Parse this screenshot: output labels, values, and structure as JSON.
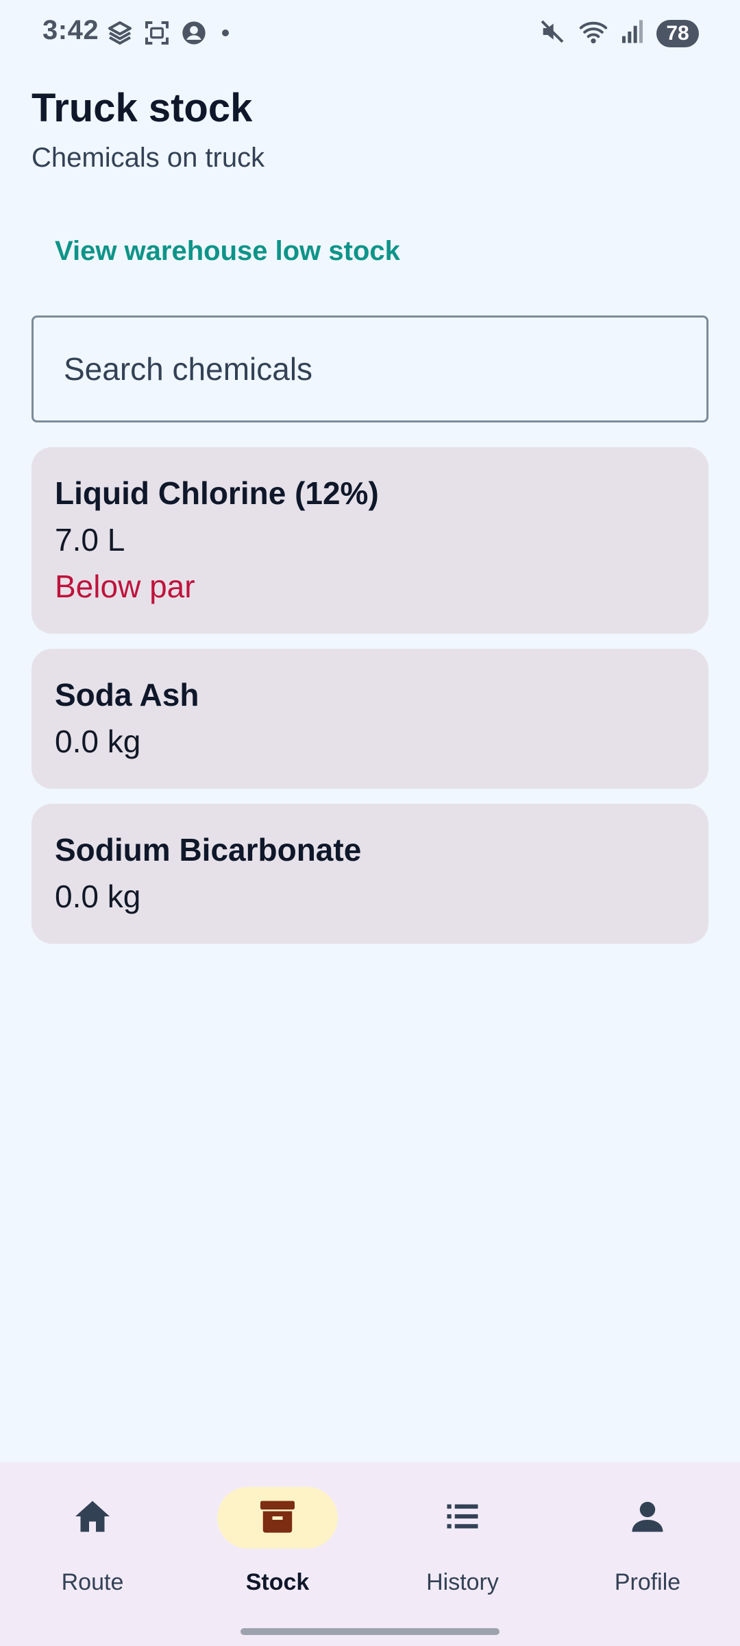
{
  "status_bar": {
    "time": "3:42",
    "battery": "78",
    "left_icons": [
      "layers-icon",
      "screenshot-icon",
      "account-circle-icon",
      "dot-icon"
    ],
    "right_icons": [
      "mute-icon",
      "wifi-icon",
      "signal-icon"
    ]
  },
  "header": {
    "title": "Truck stock",
    "subtitle": "Chemicals on truck",
    "warehouse_link": "View warehouse low stock"
  },
  "search": {
    "placeholder": "Search chemicals",
    "value": ""
  },
  "items": [
    {
      "name": "Liquid Chlorine (12%)",
      "quantity": "7.0 L",
      "status": "Below par"
    },
    {
      "name": "Soda Ash",
      "quantity": "0.0 kg",
      "status": ""
    },
    {
      "name": "Sodium Bicarbonate",
      "quantity": "0.0 kg",
      "status": ""
    }
  ],
  "nav": {
    "items": [
      {
        "label": "Route",
        "icon": "home-icon",
        "active": false
      },
      {
        "label": "Stock",
        "icon": "archive-icon",
        "active": true
      },
      {
        "label": "History",
        "icon": "list-icon",
        "active": false
      },
      {
        "label": "Profile",
        "icon": "person-icon",
        "active": false
      }
    ]
  },
  "colors": {
    "background": "#f0f7fe",
    "accent": "#0d9488",
    "warning": "#be123c",
    "card": "#e6e1e8",
    "nav_active": "#fef3c7",
    "stock_icon": "#7c2d12"
  }
}
